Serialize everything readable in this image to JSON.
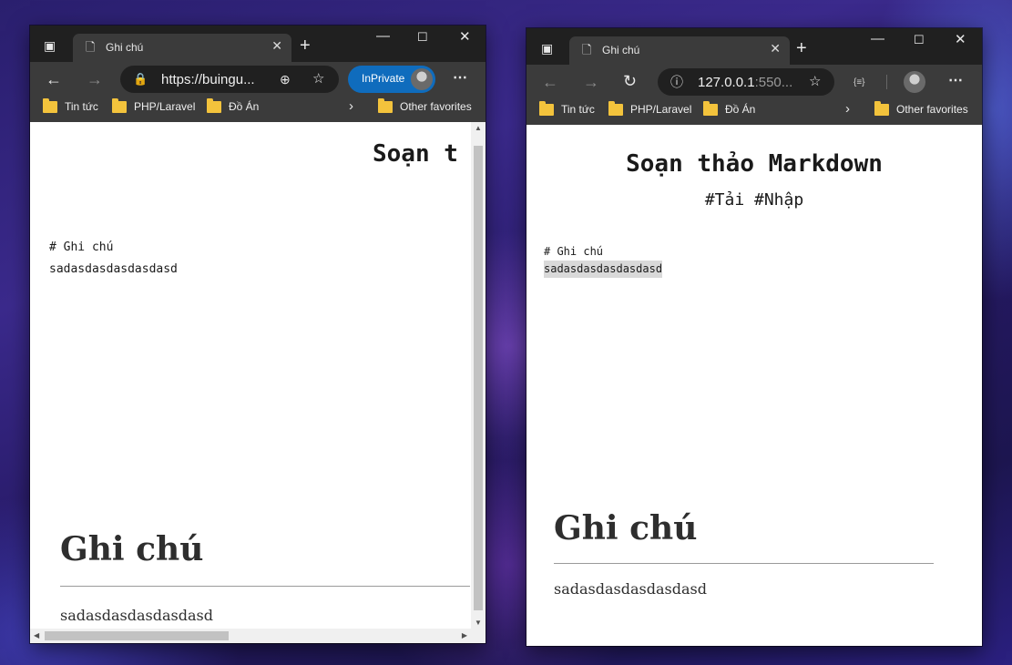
{
  "left_window": {
    "tab_title": "Ghi chú",
    "url": "https://buingu...",
    "inprivate_label": "InPrivate",
    "bookmarks": [
      "Tin tức",
      "PHP/Laravel",
      "Đồ Án"
    ],
    "other_favorites": "Other favorites",
    "page": {
      "heading": "Soạn t",
      "editor_lines": [
        "# Ghi chú",
        "sadasdasdasdasdasd"
      ],
      "preview_title": "Ghi chú",
      "preview_text": "sadasdasdasdasdasd"
    }
  },
  "right_window": {
    "tab_title": "Ghi chú",
    "url_host": "127.0.0.1",
    "url_rest": ":550...",
    "bookmarks": [
      "Tin tức",
      "PHP/Laravel",
      "Đồ Án"
    ],
    "other_favorites": "Other favorites",
    "page": {
      "heading": "Soạn thảo Markdown",
      "links": "#Tải #Nhập",
      "editor_lines": [
        "# Ghi chú",
        "sadasdasdasdasdasd"
      ],
      "preview_title": "Ghi chú",
      "preview_text": "sadasdasdasdasdasd"
    }
  },
  "icons": {
    "tab_actions": "tab-actions-icon",
    "page": "page-icon",
    "new_tab": "plus-icon",
    "back": "back-arrow-icon",
    "forward": "forward-arrow-icon",
    "refresh": "refresh-icon",
    "lock": "lock-icon",
    "info": "info-icon",
    "zoom": "zoom-icon",
    "favorite": "star-add-icon",
    "extension": "code-extension-icon",
    "more": "more-icon"
  },
  "colors": {
    "browser_frame": "#202020",
    "toolbar": "#3b3b3b",
    "inprivate_blue": "#0f6cbd",
    "folder": "#f3c33c"
  }
}
